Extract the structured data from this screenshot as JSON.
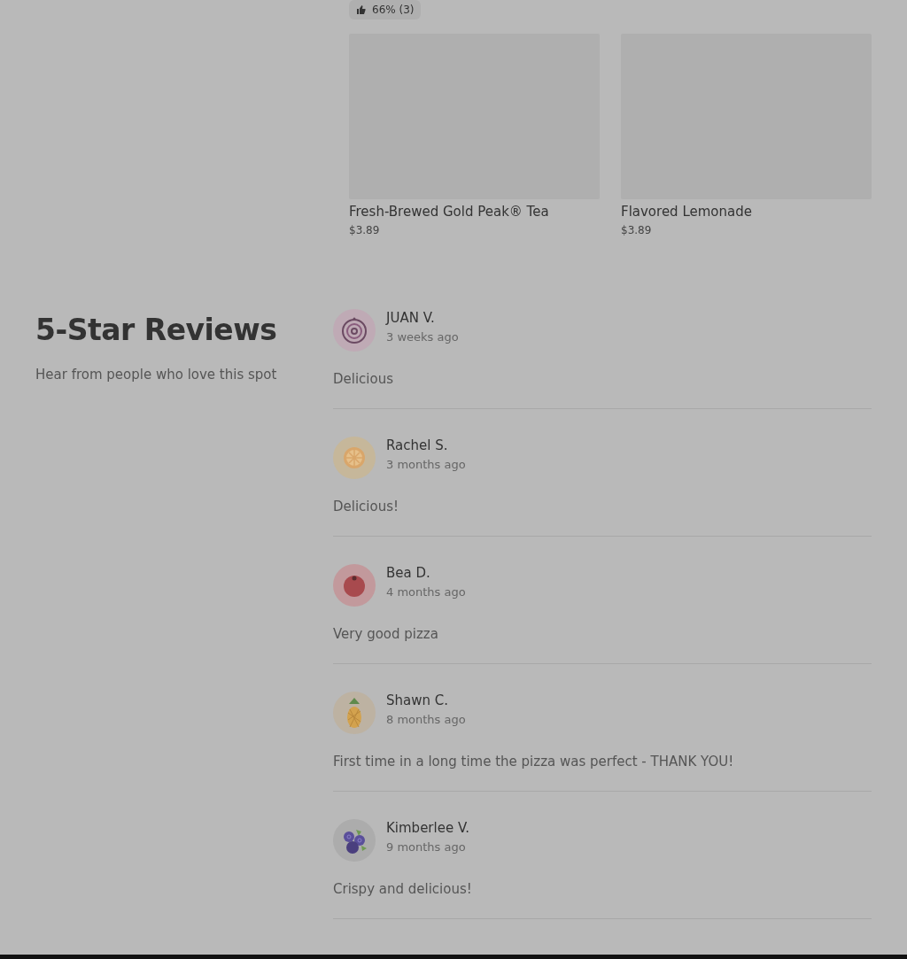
{
  "rating_badge": {
    "text": "66% (3)"
  },
  "products": [
    {
      "name": "Fresh-Brewed Gold Peak® Tea",
      "price": "$3.89"
    },
    {
      "name": "Flavored Lemonade",
      "price": "$3.89"
    }
  ],
  "reviews_section": {
    "title": "5-Star Reviews",
    "subtitle": "Hear from people who love this spot"
  },
  "reviews": [
    {
      "avatar": {
        "kind": "onion"
      },
      "name": "JUAN V.",
      "time": "3 weeks ago",
      "text": "Delicious"
    },
    {
      "avatar": {
        "kind": "lemon"
      },
      "name": "Rachel S.",
      "time": "3 months ago",
      "text": "Delicious!"
    },
    {
      "avatar": {
        "kind": "tomato"
      },
      "name": "Bea D.",
      "time": "4 months ago",
      "text": "Very good pizza"
    },
    {
      "avatar": {
        "kind": "pineapple"
      },
      "name": "Shawn C.",
      "time": "8 months ago",
      "text": "First time in a long time the pizza was perfect - THANK YOU!"
    },
    {
      "avatar": {
        "kind": "blueberry"
      },
      "name": "Kimberlee V.",
      "time": "9 months ago",
      "text": "Crispy and delicious!"
    }
  ]
}
